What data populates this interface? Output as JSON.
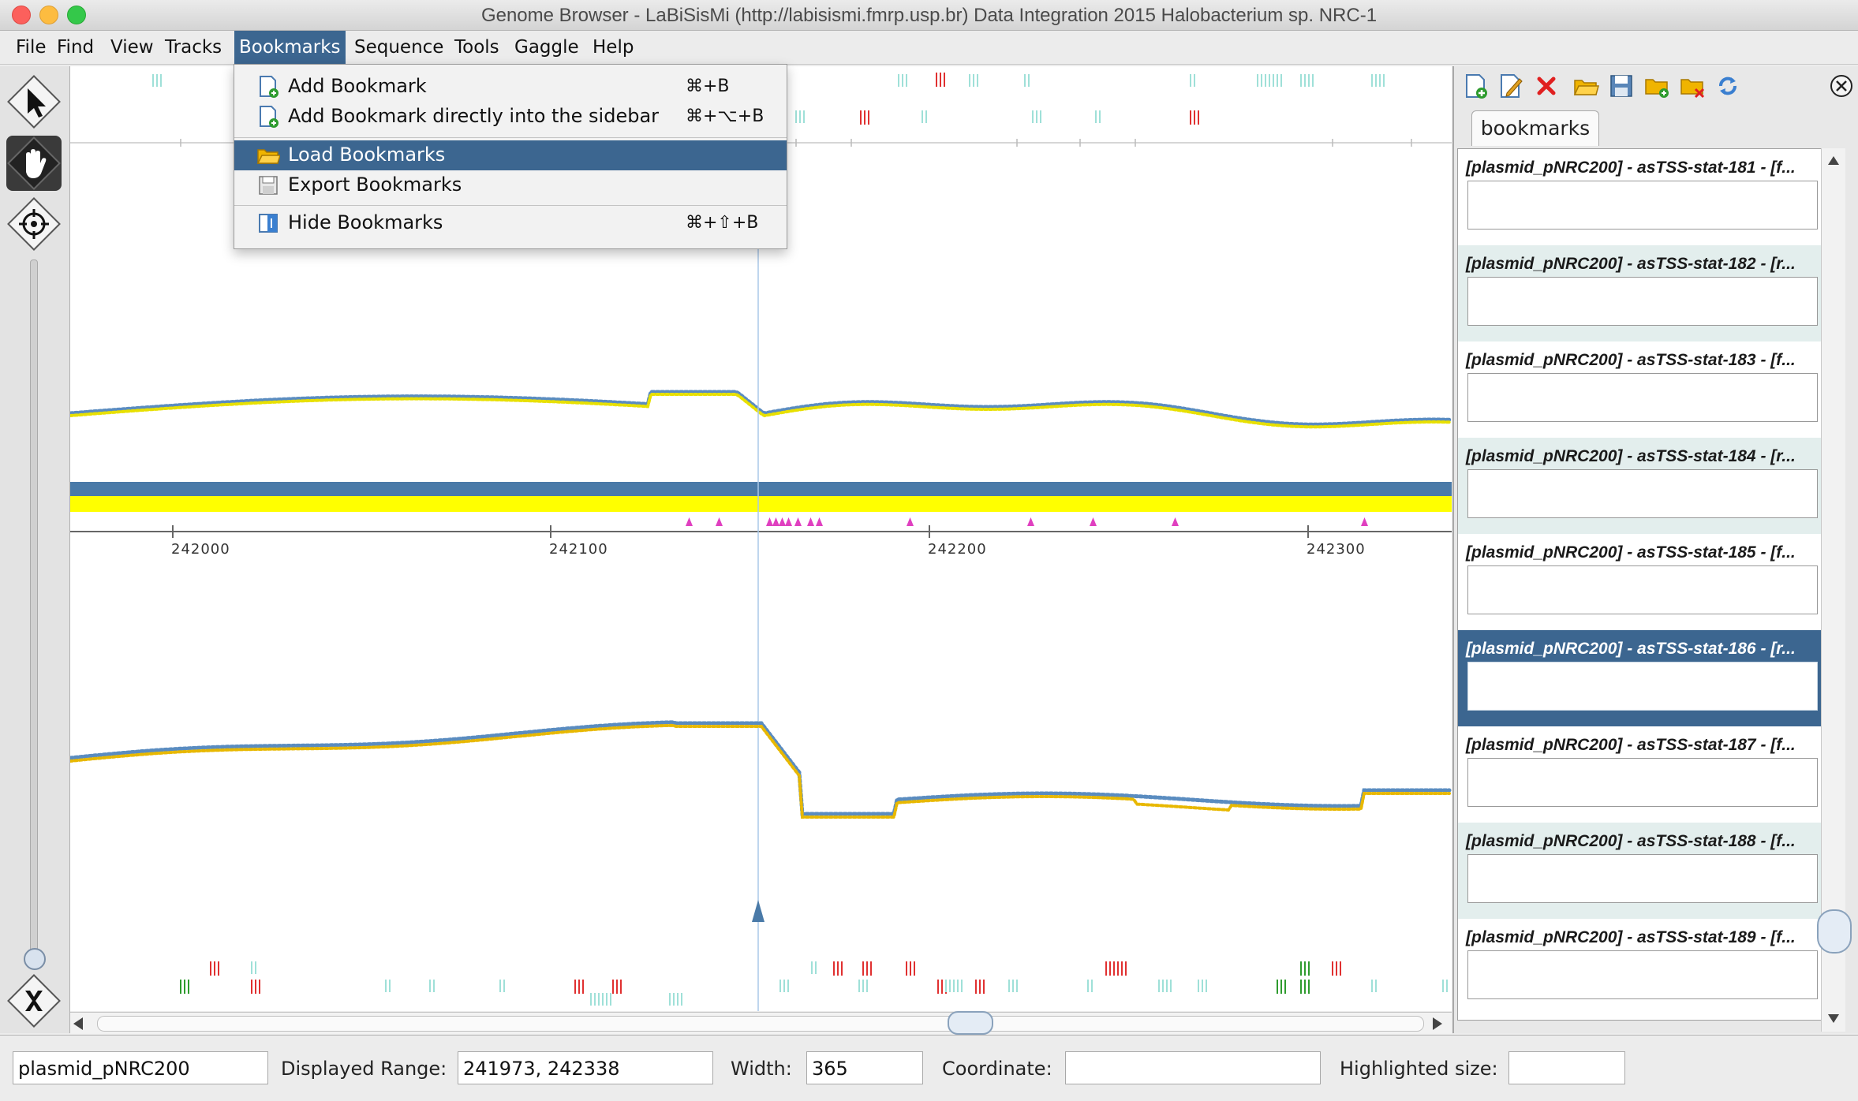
{
  "window": {
    "title": "Genome Browser - LaBiSisMi (http://labisismi.fmrp.usp.br) Data Integration 2015 Halobacterium sp. NRC-1"
  },
  "menubar": {
    "items": [
      {
        "label": "File"
      },
      {
        "label": "Find"
      },
      {
        "label": "View"
      },
      {
        "label": "Tracks"
      },
      {
        "label": "Bookmarks",
        "active": true
      },
      {
        "label": "Sequence"
      },
      {
        "label": "Tools"
      },
      {
        "label": "Gaggle"
      },
      {
        "label": "Help"
      }
    ]
  },
  "bookmarks_menu": {
    "items": [
      {
        "label": "Add Bookmark",
        "shortcut": "⌘+B",
        "icon": "add-bookmark-icon"
      },
      {
        "label": "Add Bookmark directly into the sidebar",
        "shortcut": "⌘+⌥+B",
        "icon": "add-bookmark-sidebar-icon"
      },
      {
        "label": "Load Bookmarks",
        "shortcut": "",
        "icon": "folder-open-icon",
        "highlighted": true
      },
      {
        "label": "Export Bookmarks",
        "shortcut": "",
        "icon": "save-disk-icon"
      },
      {
        "label": "Hide Bookmarks",
        "shortcut": "⌘+⇧+B",
        "icon": "hide-sidebar-icon"
      }
    ]
  },
  "toolstrip": {
    "tools": [
      "select-arrow-icon",
      "pan-hand-icon",
      "crosshair-target-icon",
      "zoom-reset-x-icon"
    ],
    "active_tool": "pan-hand-icon"
  },
  "ruler": {
    "ticks": [
      "242000",
      "242100",
      "242200",
      "242300"
    ]
  },
  "sidebar": {
    "tab_label": "bookmarks",
    "toolbar_icons": [
      "new-bookmark-icon",
      "edit-bookmark-icon",
      "delete-bookmark-icon",
      "open-folder-icon",
      "save-icon",
      "folder-add-icon",
      "folder-remove-icon",
      "sync-icon"
    ],
    "close_icon": "close-circle-icon",
    "bookmarks": [
      {
        "title": "[plasmid_pNRC200] - asTSS-stat-181 - [f...",
        "note": ""
      },
      {
        "title": "[plasmid_pNRC200] - asTSS-stat-182 - [r...",
        "note": ""
      },
      {
        "title": "[plasmid_pNRC200] - asTSS-stat-183 - [f...",
        "note": ""
      },
      {
        "title": "[plasmid_pNRC200] - asTSS-stat-184 - [r...",
        "note": ""
      },
      {
        "title": "[plasmid_pNRC200] - asTSS-stat-185 - [f...",
        "note": ""
      },
      {
        "title": "[plasmid_pNRC200] - asTSS-stat-186 - [r...",
        "note": "",
        "selected": true
      },
      {
        "title": "[plasmid_pNRC200] - asTSS-stat-187 - [f...",
        "note": ""
      },
      {
        "title": "[plasmid_pNRC200] - asTSS-stat-188 - [f...",
        "note": ""
      },
      {
        "title": "[plasmid_pNRC200] - asTSS-stat-189 - [f...",
        "note": ""
      }
    ]
  },
  "statusbar": {
    "sequence": "plasmid_pNRC200",
    "range_label": "Displayed Range:",
    "range_value": "241973, 242338",
    "width_label": "Width:",
    "width_value": "365",
    "coordinate_label": "Coordinate:",
    "coordinate_value": "",
    "highlighted_label": "Highlighted size:",
    "highlighted_value": ""
  },
  "colors": {
    "selection": "#3c6690",
    "forward_track": "#4a7aa8",
    "reverse_track": "#ffff00",
    "tss_marker": "#e040c0",
    "alt_row": "#e3eeed"
  }
}
